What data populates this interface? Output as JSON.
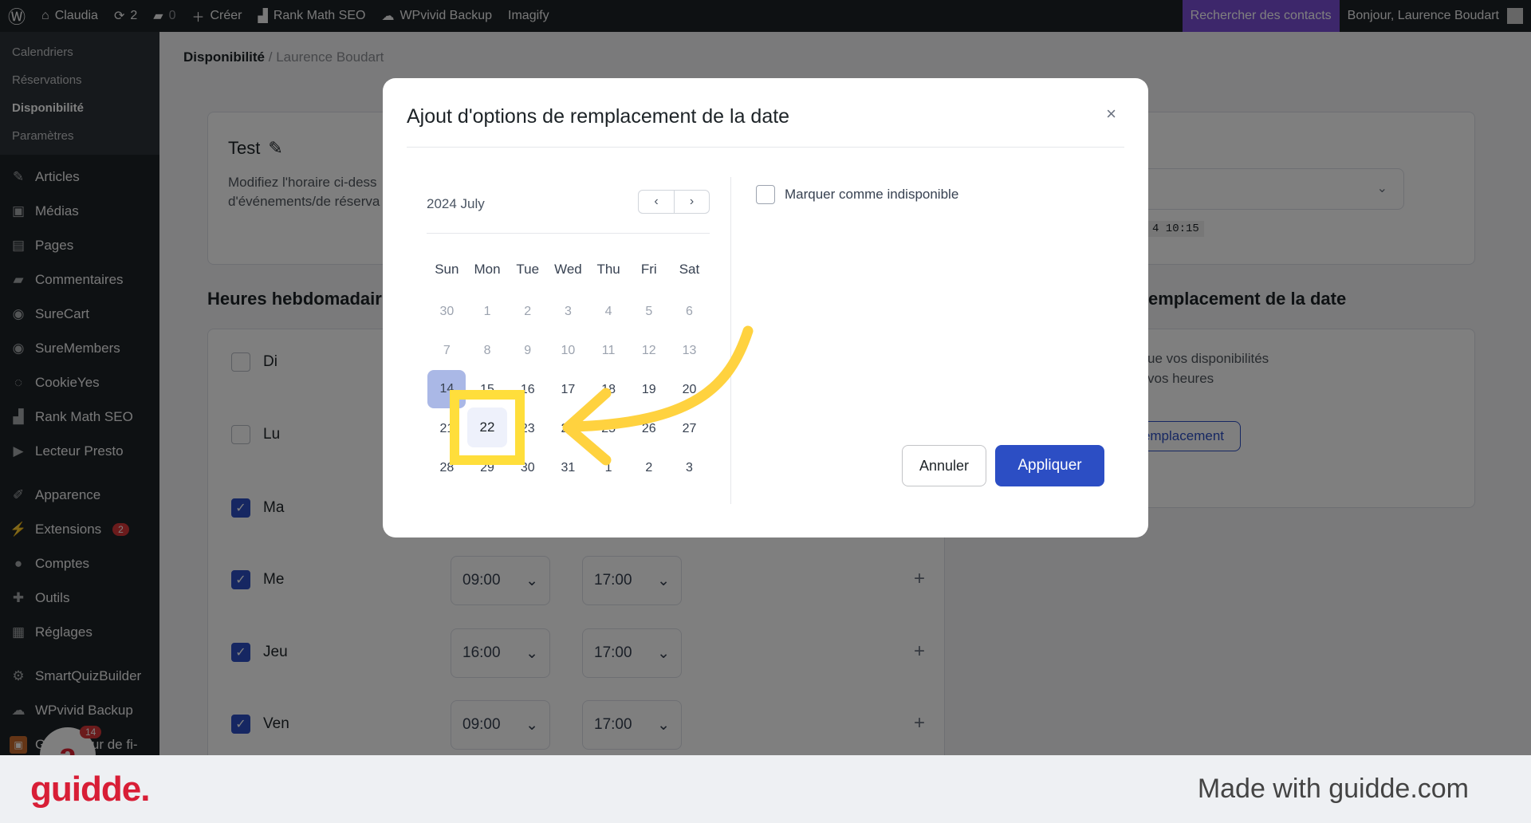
{
  "adminbar": {
    "site": "Claudia",
    "updates": "2",
    "comments": "0",
    "create": "Créer",
    "rankmath": "Rank Math SEO",
    "wpvivid": "WPvivid Backup",
    "imagify": "Imagify",
    "search_contacts": "Rechercher des contacts",
    "greeting": "Bonjour, Laurence Boudart"
  },
  "sidebar": {
    "submenu": [
      "Calendriers",
      "Réservations",
      "Disponibilité",
      "Paramètres"
    ],
    "items": [
      {
        "label": "Articles",
        "icon": "pin-icon"
      },
      {
        "label": "Médias",
        "icon": "media-icon"
      },
      {
        "label": "Pages",
        "icon": "pages-icon"
      },
      {
        "label": "Commentaires",
        "icon": "comment-icon"
      },
      {
        "label": "SureCart",
        "icon": "surecart-icon"
      },
      {
        "label": "SureMembers",
        "icon": "suremembers-icon"
      },
      {
        "label": "CookieYes",
        "icon": "cookie-icon"
      },
      {
        "label": "Rank Math SEO",
        "icon": "rankmath-icon"
      },
      {
        "label": "Lecteur Presto",
        "icon": "presto-icon"
      },
      {
        "label": "Apparence",
        "icon": "brush-icon"
      },
      {
        "label": "Extensions",
        "icon": "plugin-icon",
        "badge": "2"
      },
      {
        "label": "Comptes",
        "icon": "user-icon"
      },
      {
        "label": "Outils",
        "icon": "wrench-icon"
      },
      {
        "label": "Réglages",
        "icon": "settings-icon"
      },
      {
        "label": "SmartQuizBuilder",
        "icon": "gear-icon"
      },
      {
        "label": "WPvivid Backup",
        "icon": "cloud-icon"
      },
      {
        "label": "Générateur de fi-",
        "icon": "form-icon"
      }
    ],
    "chat_badge": "14"
  },
  "page": {
    "breadcrumb_current": "Disponibilité",
    "breadcrumb_sep": "/",
    "breadcrumb_user": "Laurence Boudart",
    "schedule_name": "Test",
    "schedule_desc": "Modifiez l'horaire ci-dess",
    "schedule_desc2": "d'événements/de réserva",
    "weekly_heading": "Heures hebdomadair",
    "override_heading": "emplacement de la date",
    "override_text1": "ue vos disponibilités",
    "override_text2": "vos heures",
    "override_btn": "remplacement",
    "timezone_time": "4 10:15",
    "days": [
      {
        "label": "Di",
        "checked": false
      },
      {
        "label": "Lu",
        "checked": false
      },
      {
        "label": "Ma",
        "checked": true
      },
      {
        "label": "Me",
        "checked": true,
        "from": "09:00",
        "to": "17:00"
      },
      {
        "label": "Jeu",
        "checked": true,
        "from": "16:00",
        "to": "17:00"
      },
      {
        "label": "Ven",
        "checked": true,
        "from": "09:00",
        "to": "17:00"
      }
    ]
  },
  "modal": {
    "title": "Ajout d'options de remplacement de la date",
    "close": "×",
    "month_label": "2024 July",
    "prev": "‹",
    "next": "›",
    "weekdays": [
      "Sun",
      "Mon",
      "Tue",
      "Wed",
      "Thu",
      "Fri",
      "Sat"
    ],
    "weeks": [
      [
        "30",
        "1",
        "2",
        "3",
        "4",
        "5",
        "6"
      ],
      [
        "7",
        "8",
        "9",
        "10",
        "11",
        "12",
        "13"
      ],
      [
        "14",
        "15",
        "16",
        "17",
        "18",
        "19",
        "20"
      ],
      [
        "21",
        "22",
        "23",
        "24",
        "25",
        "26",
        "27"
      ],
      [
        "28",
        "29",
        "30",
        "31",
        "1",
        "2",
        "3"
      ]
    ],
    "selected_day": "22",
    "unavailable_label": "Marquer comme indisponible",
    "cancel": "Annuler",
    "apply": "Appliquer"
  },
  "footer": {
    "logo": "guidde.",
    "made_with": "Made with guidde.com"
  },
  "colors": {
    "accent": "#2c4ec4",
    "highlight": "#ffde3b",
    "brand": "#d81e36"
  }
}
